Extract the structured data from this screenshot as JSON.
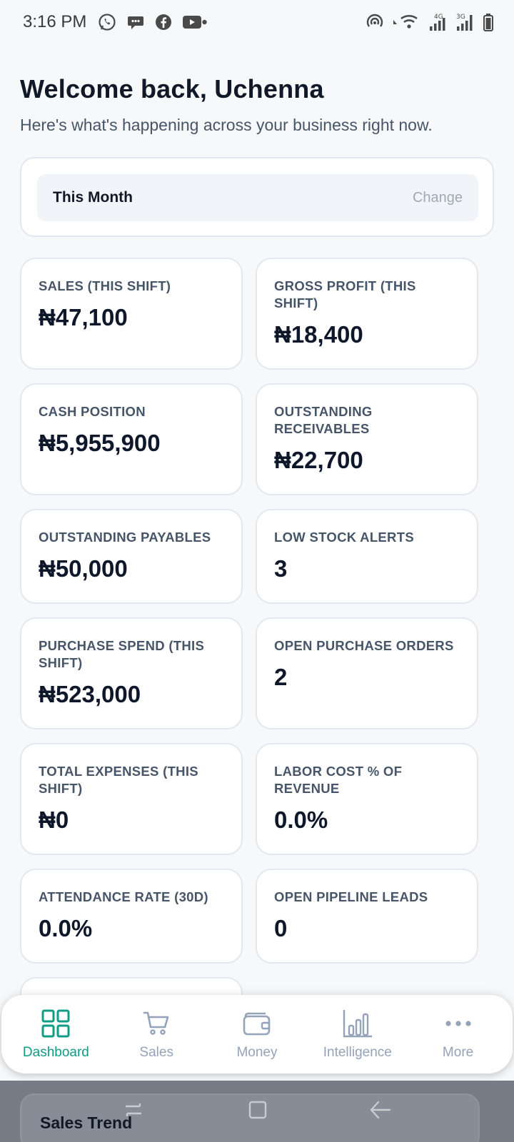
{
  "status_bar": {
    "time": "3:16 PM",
    "left_icons": [
      "whatsapp-icon",
      "chat-bubble-icon",
      "facebook-icon",
      "youtube-icon"
    ],
    "right_icons": [
      "hotspot-icon",
      "wifi-icon",
      "signal-4g-icon",
      "signal-3g-icon",
      "battery-icon"
    ],
    "signal_labels": [
      "4G",
      "3G"
    ]
  },
  "header": {
    "welcome": "Welcome back, Uchenna",
    "subtitle": "Here's what's happening across your business right now."
  },
  "period": {
    "label": "This Month",
    "change": "Change"
  },
  "kpis": [
    {
      "label": "SALES (THIS SHIFT)",
      "value": "₦47,100"
    },
    {
      "label": "GROSS PROFIT (THIS SHIFT)",
      "value": "₦18,400"
    },
    {
      "label": "CASH POSITION",
      "value": "₦5,955,900"
    },
    {
      "label": "OUTSTANDING RECEIVABLES",
      "value": "₦22,700"
    },
    {
      "label": "OUTSTANDING PAYABLES",
      "value": "₦50,000"
    },
    {
      "label": "LOW STOCK ALERTS",
      "value": "3"
    },
    {
      "label": "PURCHASE SPEND (THIS SHIFT)",
      "value": "₦523,000"
    },
    {
      "label": "OPEN PURCHASE ORDERS",
      "value": "2"
    },
    {
      "label": "TOTAL EXPENSES (THIS SHIFT)",
      "value": "₦0"
    },
    {
      "label": "LABOR COST % OF REVENUE",
      "value": "0.0%"
    },
    {
      "label": "ATTENDANCE RATE (30D)",
      "value": "0.0%"
    },
    {
      "label": "OPEN PIPELINE LEADS",
      "value": "0"
    }
  ],
  "bottom_nav": {
    "items": [
      {
        "label": "Dashboard",
        "icon": "grid-icon",
        "active": true
      },
      {
        "label": "Sales",
        "icon": "cart-icon",
        "active": false
      },
      {
        "label": "Money",
        "icon": "wallet-icon",
        "active": false
      },
      {
        "label": "Intelligence",
        "icon": "bar-chart-icon",
        "active": false
      },
      {
        "label": "More",
        "icon": "more-dots-icon",
        "active": false
      }
    ]
  },
  "peek": {
    "title": "Sales Trend"
  },
  "colors": {
    "accent": "#0f9d86",
    "inactive": "#94a3b8",
    "text": "#0f172a",
    "background": "#f6f8fa"
  }
}
